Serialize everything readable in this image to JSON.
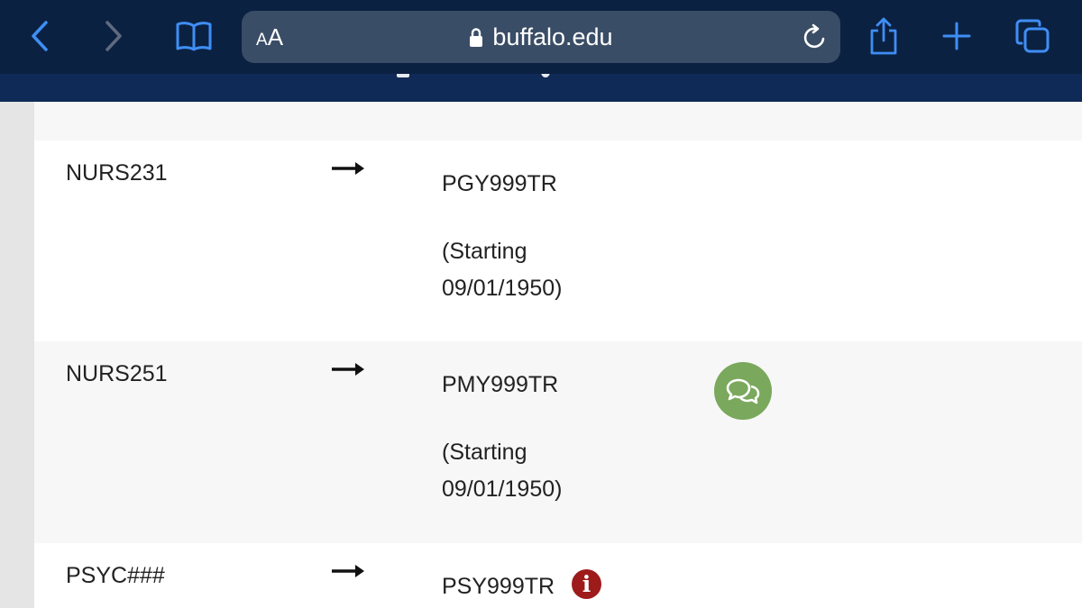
{
  "browser": {
    "url": "buffalo.edu",
    "text_size_label": "AA",
    "colors": {
      "toolbar_bg": "#0b2142",
      "url_bar_bg": "#3a4d66",
      "icon_blue": "#3f8ef5"
    },
    "icons": [
      "back-icon",
      "forward-icon",
      "bookmarks-icon",
      "lock-icon",
      "reload-icon",
      "share-icon",
      "new-tab-icon",
      "tabs-icon"
    ]
  },
  "rows": [
    {
      "course": "NURS231",
      "equivalent": "PGY999TR",
      "note_line1": "(Starting",
      "note_line2": "09/01/1950)"
    },
    {
      "course": "NURS251",
      "equivalent": "PMY999TR",
      "note_line1": "(Starting",
      "note_line2": "09/01/1950)",
      "badge": "chat-icon"
    },
    {
      "course": "PSYC###",
      "equivalent": "PSY999TR",
      "badge": "info-icon"
    }
  ],
  "colors": {
    "chat_badge": "#7aa85c",
    "info_badge": "#9e1b1b",
    "page_header": "#0f2a56"
  }
}
